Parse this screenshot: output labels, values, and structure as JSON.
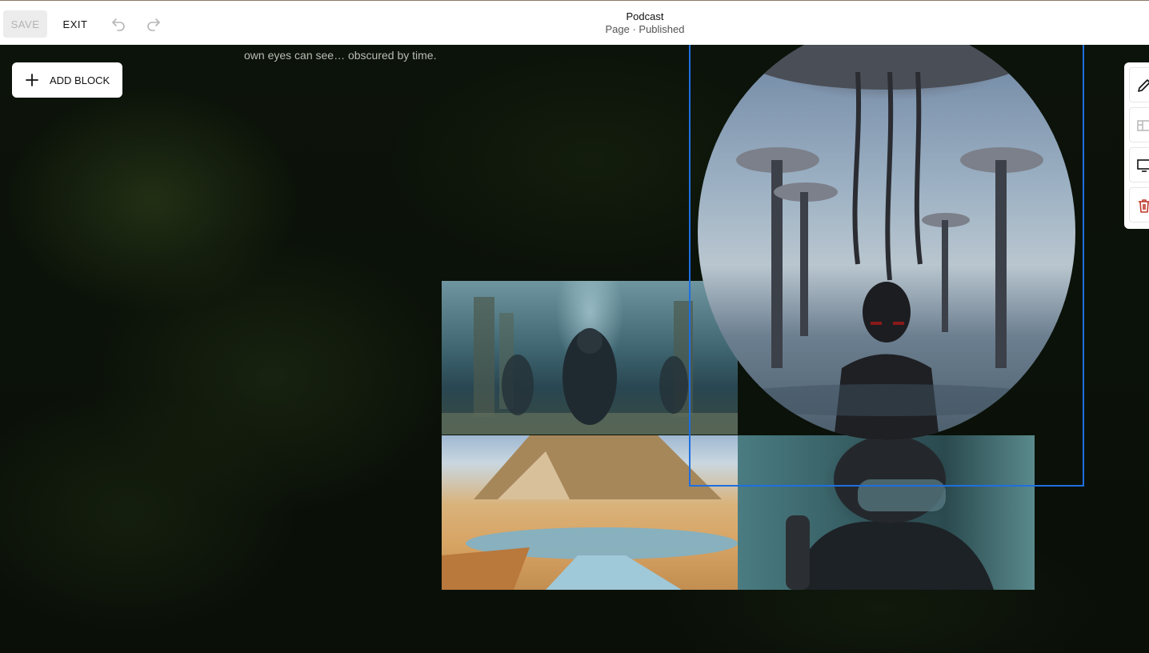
{
  "topbar": {
    "save_label": "SAVE",
    "exit_label": "EXIT",
    "undo_icon": "undo-icon",
    "redo_icon": "redo-icon",
    "page_title": "Podcast",
    "page_status": "Page · Published"
  },
  "content": {
    "body_text": "own eyes can see… obscured by time."
  },
  "add_block": {
    "label": "ADD BLOCK",
    "icon": "plus-icon"
  },
  "gallery": {
    "images": [
      {
        "name": "divers-in-underwater-ruins"
      },
      {
        "name": "alien-figure-with-jellyfish-ships"
      },
      {
        "name": "desert-pyramid-with-river"
      },
      {
        "name": "diver-in-helmet-close-up"
      }
    ],
    "selection_color": "#1e6fe0"
  },
  "side_toolbar": {
    "items": [
      "edit-icon",
      "layout-icon",
      "desktop-icon",
      "trash-icon"
    ],
    "trash_color": "#c0392b"
  }
}
